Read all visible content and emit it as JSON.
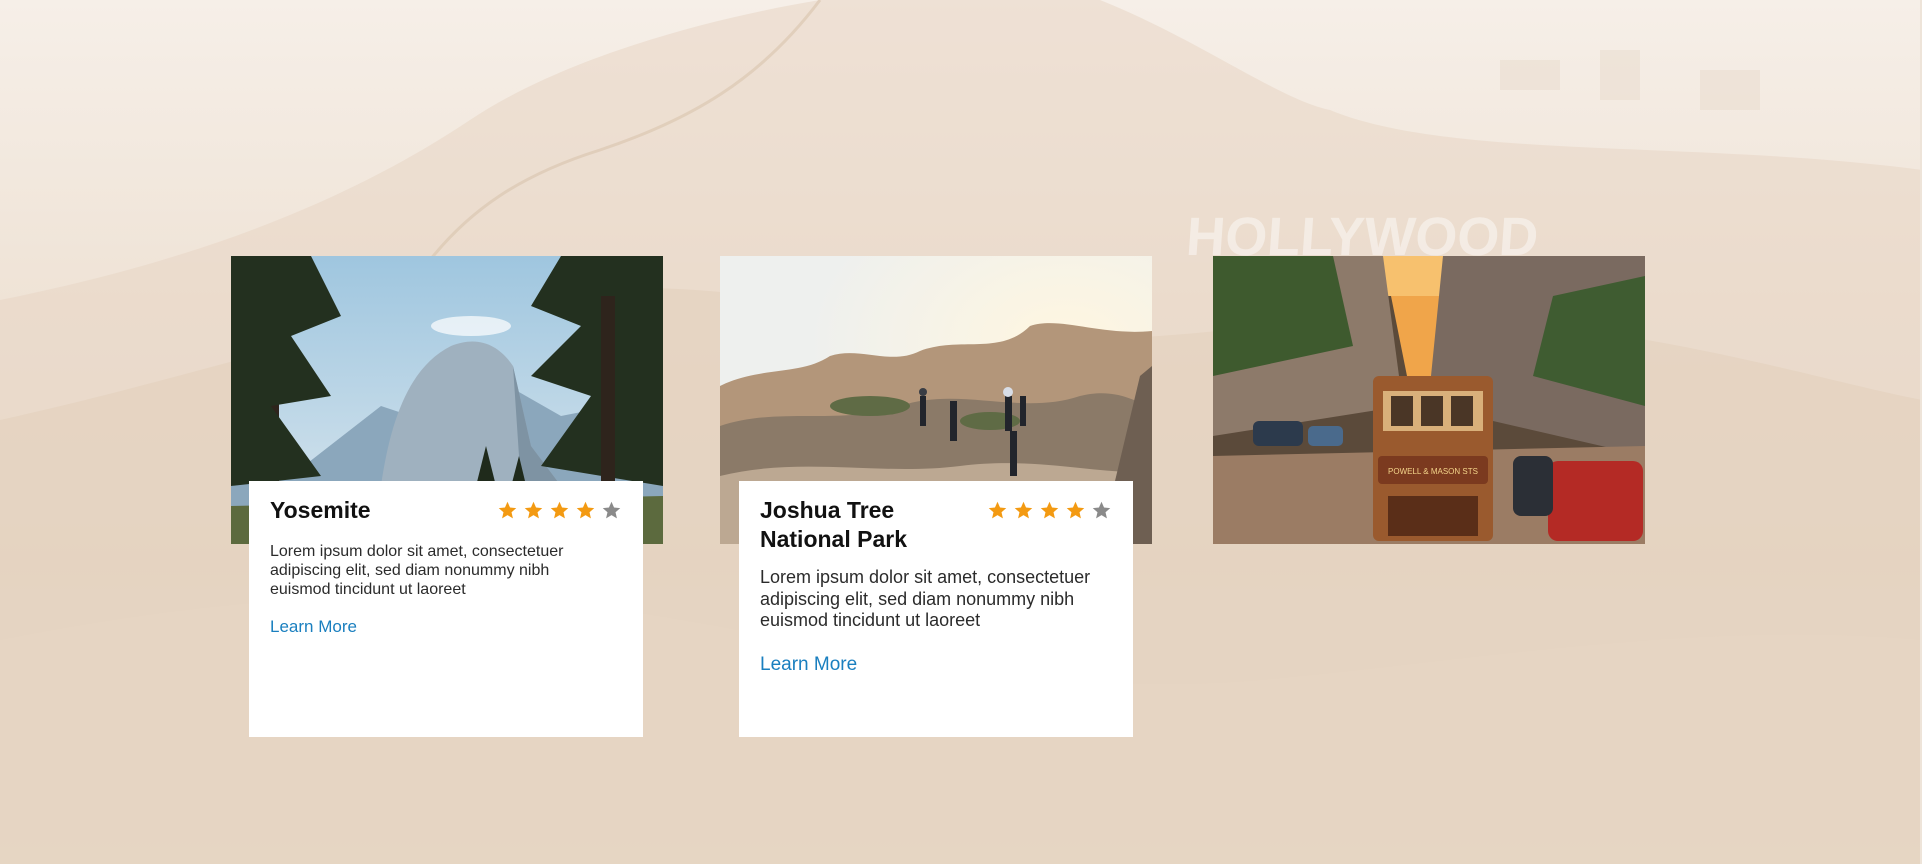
{
  "colors": {
    "accent_link": "#1a7fbf",
    "star_filled": "#f39a12",
    "star_empty": "#8a8a8a",
    "card_background": "#ffffff",
    "page_background": "#efe3d6"
  },
  "background": {
    "image": "hollywood-hills-photo",
    "sign_text": "HOLLYWOOD"
  },
  "cards": [
    {
      "title": "Yosemite",
      "image": "yosemite-half-dome-photo",
      "rating": 4,
      "max_rating": 5,
      "description": "Lorem ipsum dolor sit amet, consectetuer adipiscing elit, sed diam nonummy nibh euismod tincidunt ut laoreet",
      "link_label": "Learn More"
    },
    {
      "title": "Joshua Tree National Park",
      "image": "joshua-tree-rocks-photo",
      "rating": 4,
      "max_rating": 5,
      "description": "Lorem ipsum dolor sit amet, consectetuer adipiscing elit, sed diam nonummy nibh euismod tincidunt ut laoreet",
      "link_label": "Learn More"
    },
    {
      "image": "san-francisco-cable-car-photo",
      "cable_car_sign": "POWELL & MASON STS"
    }
  ]
}
